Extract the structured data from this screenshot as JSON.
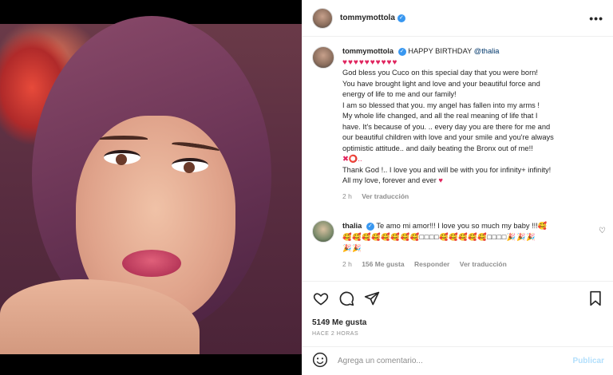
{
  "post": {
    "author": "tommymottola",
    "more_icon": "more-horizontal-icon"
  },
  "caption": {
    "author": "tommymottola",
    "greeting": "HAPPY BIRTHDAY",
    "mention": "@thalia",
    "hearts": "♥♥♥♥♥♥♥♥♥♥",
    "lines": [
      "God bless you Cuco on this special day that you were born!",
      "You have brought light and love and your beautiful force and",
      "energy of life to me and our family!",
      "I am so blessed that you. my angel has fallen into my arms !",
      "My whole life changed, and all the real meaning of life that I",
      "have. It's because of you. .. every day you are there for me and",
      "our beautiful children with love and your smile and you're always",
      "optimistic attitude.. and daily beating the Bronx out of me!!",
      "✖⭕..",
      "Thank God !.. I love you and will be with you for infinity+ infinity!",
      "All my love, forever and ever"
    ],
    "final_heart": "♥",
    "time": "2 h",
    "translate": "Ver traducción"
  },
  "comment": {
    "author": "thalia",
    "text": "Te amo mi amor!!! I love you so much my baby !!!🥰",
    "emojis_line1": "🥰🥰🥰🥰🥰🥰🥰🥰□□□□🥰🥰🥰🥰🥰□□□□🎉🎉🎉",
    "emojis_line2": "🎉🎉",
    "time": "2 h",
    "likes": "156 Me gusta",
    "reply": "Responder",
    "translate": "Ver traducción"
  },
  "actions": {
    "likes": "5149 Me gusta",
    "time": "HACE 2 HORAS"
  },
  "add_comment": {
    "placeholder": "Agrega un comentario...",
    "publish": "Publicar"
  },
  "colors": {
    "verified": "#3897f0",
    "heart": "#e0245e",
    "link": "#00376b",
    "publish_disabled": "#b2dffc"
  }
}
